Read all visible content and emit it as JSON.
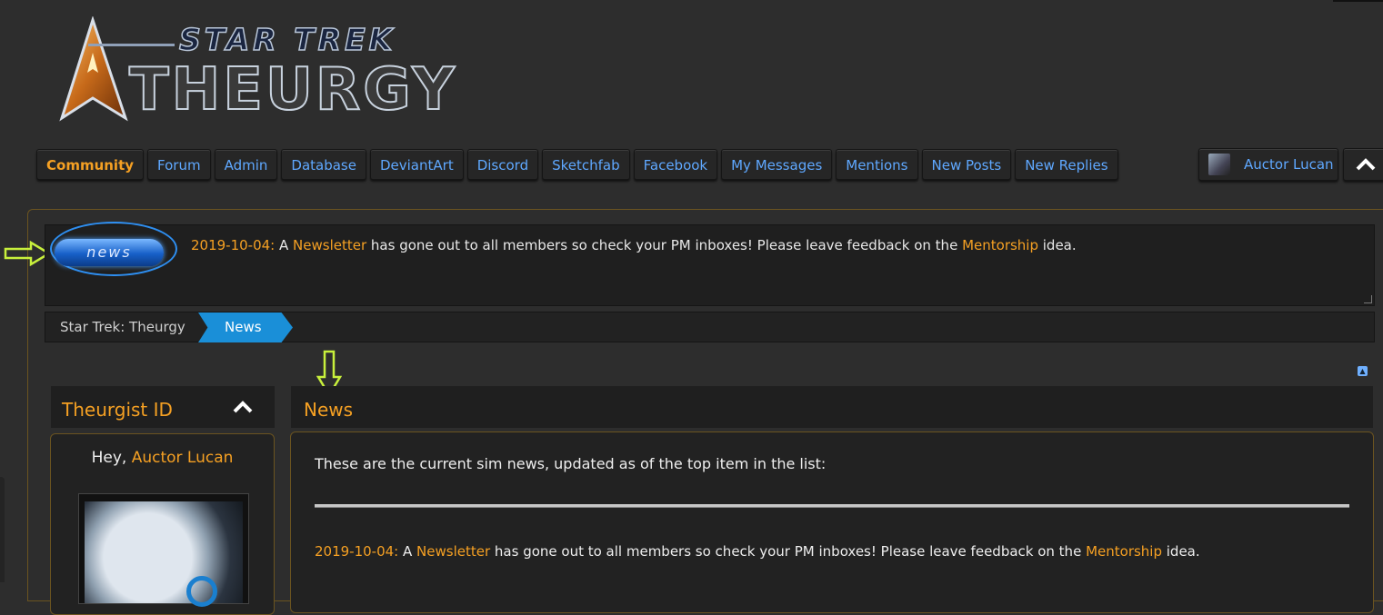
{
  "site": {
    "logo_line1": "STAR TREK",
    "logo_line2": "THEURGY"
  },
  "nav": {
    "items": [
      "Community",
      "Forum",
      "Admin",
      "Database",
      "DeviantArt",
      "Discord",
      "Sketchfab",
      "Facebook",
      "My Messages",
      "Mentions",
      "New Posts",
      "New Replies"
    ],
    "active": "Community",
    "user_name": "Auctor Lucan",
    "collapse_icon": "chevron-up-icon"
  },
  "notice": {
    "badge": "news",
    "date": "2019-10-04:",
    "part1": " A ",
    "link1": "Newsletter",
    "part2": " has gone out to all members so check your PM inboxes! Please leave feedback on the ",
    "link2": "Mentorship",
    "part3": " idea."
  },
  "breadcrumb": {
    "home": "Star Trek: Theurgy",
    "current": "News"
  },
  "sidebar": {
    "title": "Theurgist ID",
    "greeting": "Hey, ",
    "user_name": "Auctor Lucan"
  },
  "main": {
    "title": "News",
    "intro": "These are the current sim news, updated as of the top item in the list:",
    "item": {
      "date": "2019-10-04:",
      "part1": " A ",
      "link1": "Newsletter",
      "part2": " has gone out to all members so check your PM inboxes! Please leave feedback on the ",
      "link2": "Mentorship",
      "part3": " idea."
    }
  },
  "colors": {
    "accent_orange": "#f5a023",
    "link_blue": "#5fa8ff",
    "breadcrumb_active": "#1a8fd8",
    "annotation_arrow": "#c8f03c"
  }
}
